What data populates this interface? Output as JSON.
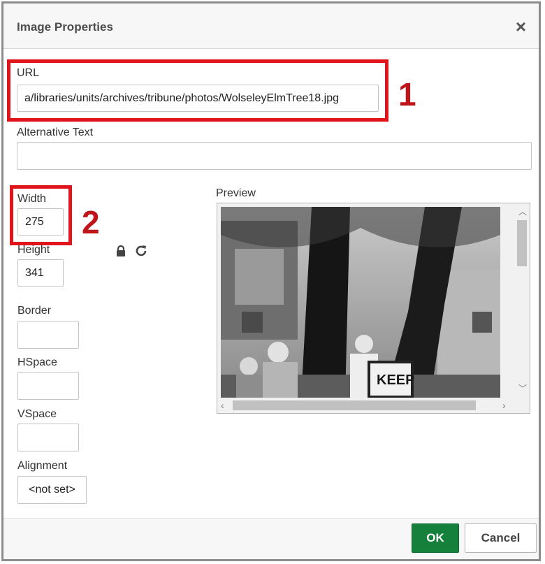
{
  "dialog": {
    "title": "Image Properties",
    "close_icon": "close-icon"
  },
  "fields": {
    "url": {
      "label": "URL",
      "value": "a/libraries/units/archives/tribune/photos/WolseleyElmTree18.jpg"
    },
    "alt": {
      "label": "Alternative Text",
      "value": ""
    },
    "width": {
      "label": "Width",
      "value": "275"
    },
    "height": {
      "label": "Height",
      "value": "341"
    },
    "border": {
      "label": "Border",
      "value": ""
    },
    "hspace": {
      "label": "HSpace",
      "value": ""
    },
    "vspace": {
      "label": "VSpace",
      "value": ""
    },
    "alignment": {
      "label": "Alignment",
      "value": "<not set>"
    }
  },
  "preview": {
    "label": "Preview",
    "sign_text": "KEEP"
  },
  "annotations": {
    "one": "1",
    "two": "2",
    "color": "#e2141b"
  },
  "buttons": {
    "ok": "OK",
    "cancel": "Cancel"
  },
  "icons": {
    "lock": "lock-icon",
    "reset": "reset-size-icon"
  },
  "colors": {
    "ok_bg": "#15803c"
  }
}
